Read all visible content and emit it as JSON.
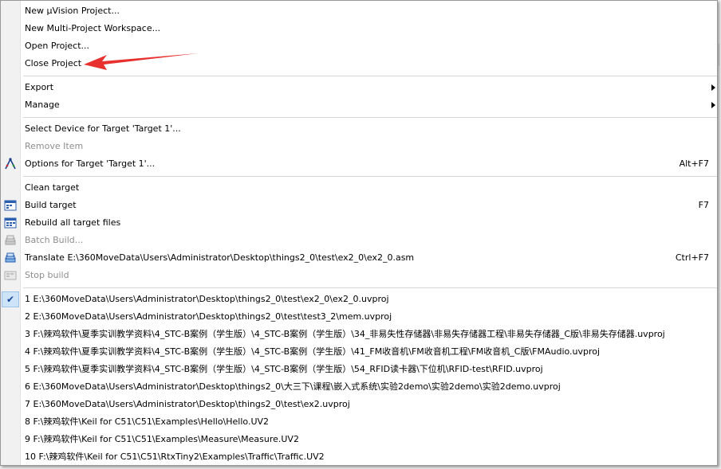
{
  "file_menu": {
    "project_group": [
      {
        "label": "New µVision Project..."
      },
      {
        "label": "New Multi-Project Workspace..."
      },
      {
        "label": "Open Project..."
      },
      {
        "label": "Close Project"
      }
    ],
    "submenu_group": [
      {
        "label": "Export",
        "has_submenu": true
      },
      {
        "label": "Manage",
        "has_submenu": true
      }
    ],
    "target_group": [
      {
        "label": "Select Device for Target 'Target 1'...",
        "enabled": true
      },
      {
        "label": "Remove Item",
        "enabled": false
      },
      {
        "label": "Options for Target 'Target 1'...",
        "shortcut": "Alt+F7",
        "enabled": true,
        "icon": "target-options-icon"
      }
    ],
    "build_group": [
      {
        "label": "Clean target",
        "enabled": true
      },
      {
        "label": "Build target",
        "shortcut": "F7",
        "enabled": true,
        "icon": "build-icon"
      },
      {
        "label": "Rebuild all target files",
        "enabled": true,
        "icon": "rebuild-icon"
      },
      {
        "label": "Batch Build...",
        "enabled": false,
        "icon": "batch-build-icon"
      },
      {
        "label": "Translate E:\\360MoveData\\Users\\Administrator\\Desktop\\things2_0\\test\\ex2_0\\ex2_0.asm",
        "shortcut": "Ctrl+F7",
        "enabled": true,
        "icon": "translate-icon"
      },
      {
        "label": "Stop build",
        "enabled": false,
        "icon": "stop-build-icon"
      }
    ],
    "recent_projects": [
      {
        "label": "1 E:\\360MoveData\\Users\\Administrator\\Desktop\\things2_0\\test\\ex2_0\\ex2_0.uvproj",
        "checked": true
      },
      {
        "label": "2 E:\\360MoveData\\Users\\Administrator\\Desktop\\things2_0\\test\\test3_2\\mem.uvproj"
      },
      {
        "label": "3 F:\\辣鸡软件\\夏季实训教学资料\\4_STC-B案例（学生版）\\4_STC-B案例（学生版）\\34_非易失性存储器\\非易失存储器工程\\非易失存储器_C版\\非易失存储器.uvproj"
      },
      {
        "label": "4 F:\\辣鸡软件\\夏季实训教学资料\\4_STC-B案例（学生版）\\4_STC-B案例（学生版）\\41_FM收音机\\FM收音机工程\\FM收音机_C版\\FMAudio.uvproj"
      },
      {
        "label": "5 F:\\辣鸡软件\\夏季实训教学资料\\4_STC-B案例（学生版）\\4_STC-B案例（学生版）\\54_RFID读卡器\\下位机\\RFID-test\\RFID.uvproj"
      },
      {
        "label": "6 E:\\360MoveData\\Users\\Administrator\\Desktop\\things2_0\\大三下\\课程\\嵌入式系统\\实验2demo\\实验2demo\\实验2demo.uvproj"
      },
      {
        "label": "7 E:\\360MoveData\\Users\\Administrator\\Desktop\\things2_0\\test\\ex2.uvproj"
      },
      {
        "label": "8 F:\\辣鸡软件\\Keil for C51\\C51\\Examples\\Hello\\Hello.UV2"
      },
      {
        "label": "9 F:\\辣鸡软件\\Keil for C51\\C51\\Examples\\Measure\\Measure.UV2"
      },
      {
        "label": "10 F:\\辣鸡软件\\Keil for C51\\C51\\RtxTiny2\\Examples\\Traffic\\Traffic.UV2"
      }
    ]
  },
  "annotation": {
    "type": "arrow",
    "color": "#e8312f",
    "points_to": "Close Project"
  },
  "colors": {
    "menu_bg": "#ffffff",
    "gutter_bg": "#f1f1f1",
    "disabled_text": "#8d8d8d",
    "check_bg": "#cde3f7"
  }
}
